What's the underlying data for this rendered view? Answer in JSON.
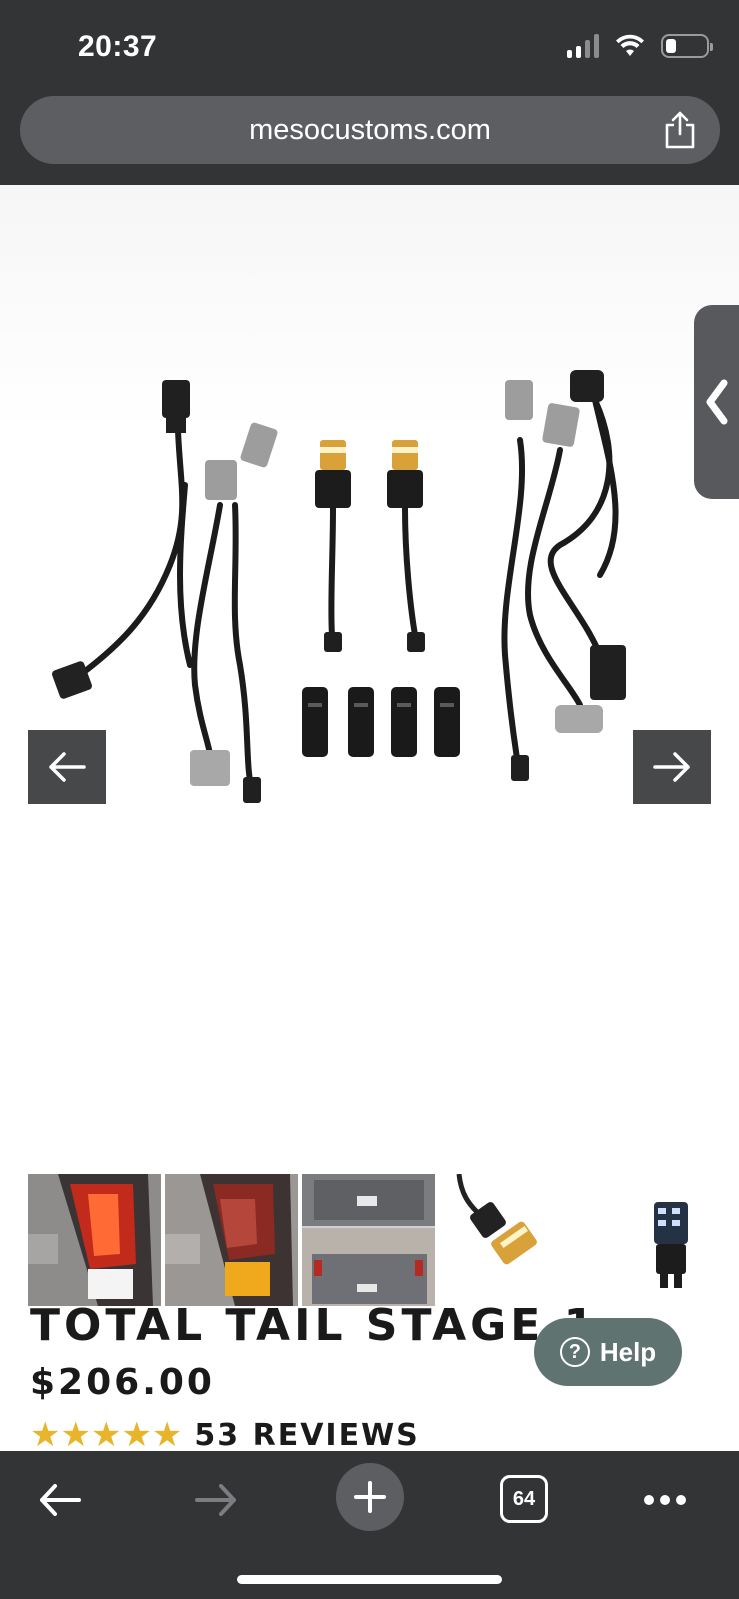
{
  "status_bar": {
    "time": "20:37",
    "signal_icon": "cellular-signal-icon",
    "wifi_icon": "wifi-icon",
    "battery_icon": "battery-icon",
    "battery_level": 0.25
  },
  "browser": {
    "url": "mesocustoms.com",
    "share_icon": "share-icon",
    "side_tab_icon": "chevron-left-icon"
  },
  "product": {
    "image_alt_icon": "wiring-harness-kit-image",
    "prev_icon": "arrow-left-icon",
    "next_icon": "arrow-right-icon",
    "thumbnails": [
      {
        "icon": "tail-light-red-thumbnail"
      },
      {
        "icon": "tail-light-amber-thumbnail"
      },
      {
        "icon": "truck-rear-thumbnail"
      },
      {
        "icon": "led-bulb-wire-thumbnail"
      },
      {
        "icon": "led-bulb-thumbnail"
      }
    ],
    "title": "TOTAL TAIL STAGE 1",
    "price": "$206.00",
    "rating_stars": 5,
    "stars": "★★★★★",
    "reviews": "53 REVIEWS"
  },
  "help": {
    "label": "Help",
    "icon_glyph": "?"
  },
  "toolbar": {
    "back_icon": "arrow-left-icon",
    "forward_icon": "arrow-right-icon",
    "new_tab_icon": "plus-icon",
    "tab_count": "64",
    "more_icon": "ellipsis-icon"
  },
  "colors": {
    "chrome": "#333436",
    "url_bar": "#5c5e62",
    "star": "#e8b429",
    "help": "#5f7371"
  }
}
